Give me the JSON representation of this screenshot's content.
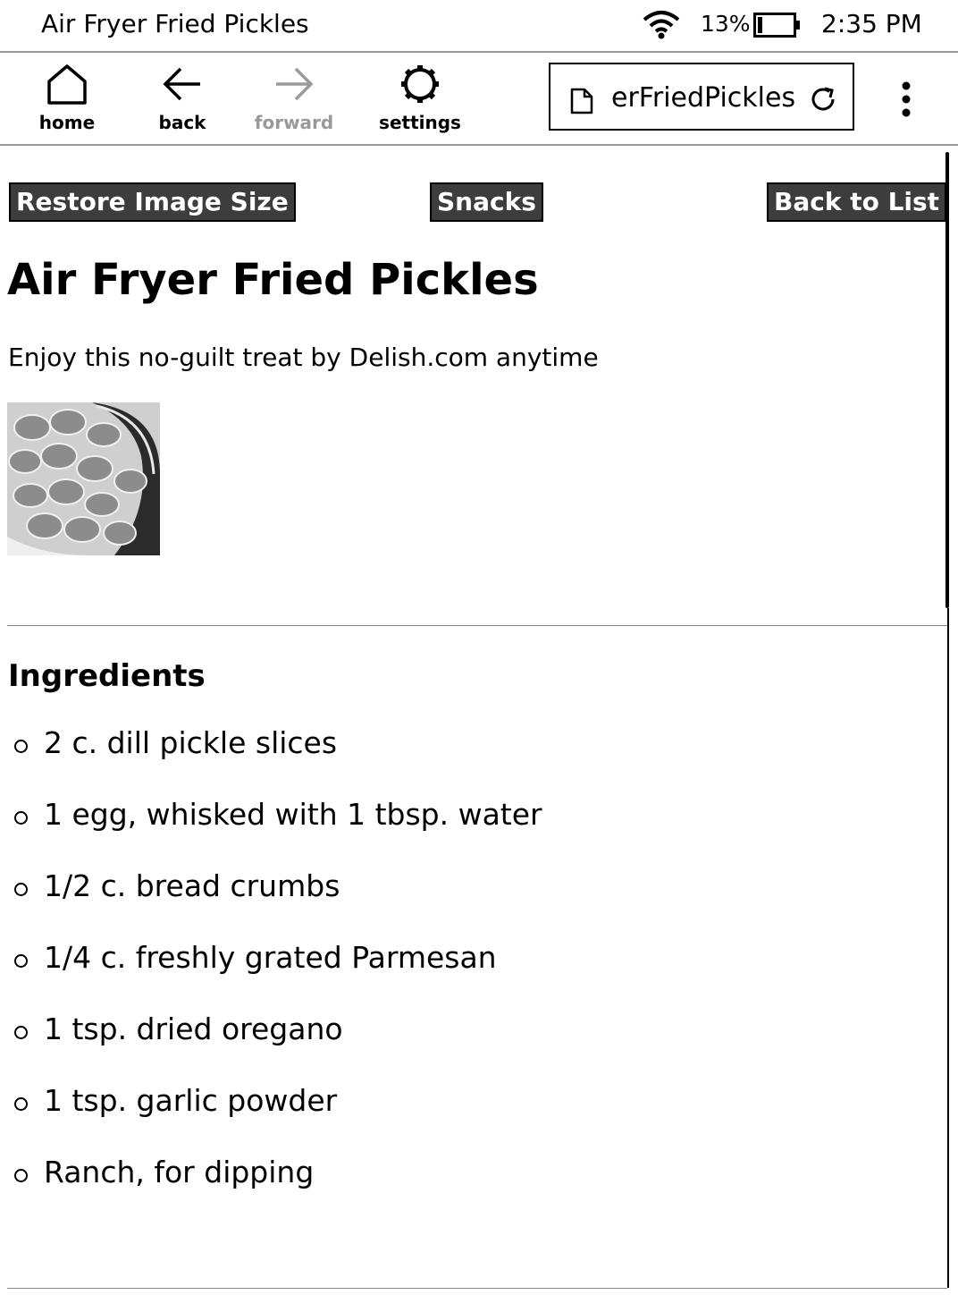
{
  "status_bar": {
    "title": "Air Fryer Fried Pickles",
    "battery": "13%",
    "time": "2:35 PM",
    "icons": [
      "wifi-icon",
      "battery-icon"
    ]
  },
  "toolbar": {
    "home_label": "home",
    "back_label": "back",
    "forward_label": "forward",
    "settings_label": "settings",
    "url": "erFriedPickles",
    "icons": [
      "home-icon",
      "back-arrow-icon",
      "forward-arrow-icon",
      "gear-icon",
      "document-icon",
      "reload-icon",
      "more-vertical-icon"
    ]
  },
  "page": {
    "buttons": {
      "restore": "Restore Image Size",
      "category": "Snacks",
      "back_to_list": "Back to List"
    },
    "title": "Air Fryer Fried Pickles",
    "description": "Enjoy this no-guilt treat by Delish.com anytime",
    "ingredients_heading": "Ingredients",
    "ingredients": [
      "2 c. dill pickle slices",
      "1 egg, whisked with 1 tbsp. water",
      "1/2 c. bread crumbs",
      "1/4 c. freshly grated Parmesan",
      "1 tsp. dried oregano",
      "1 tsp. garlic powder",
      "Ranch, for dipping"
    ]
  },
  "colors": {
    "button_bg": "#3d3d3d",
    "disabled": "#9a9a9a"
  }
}
